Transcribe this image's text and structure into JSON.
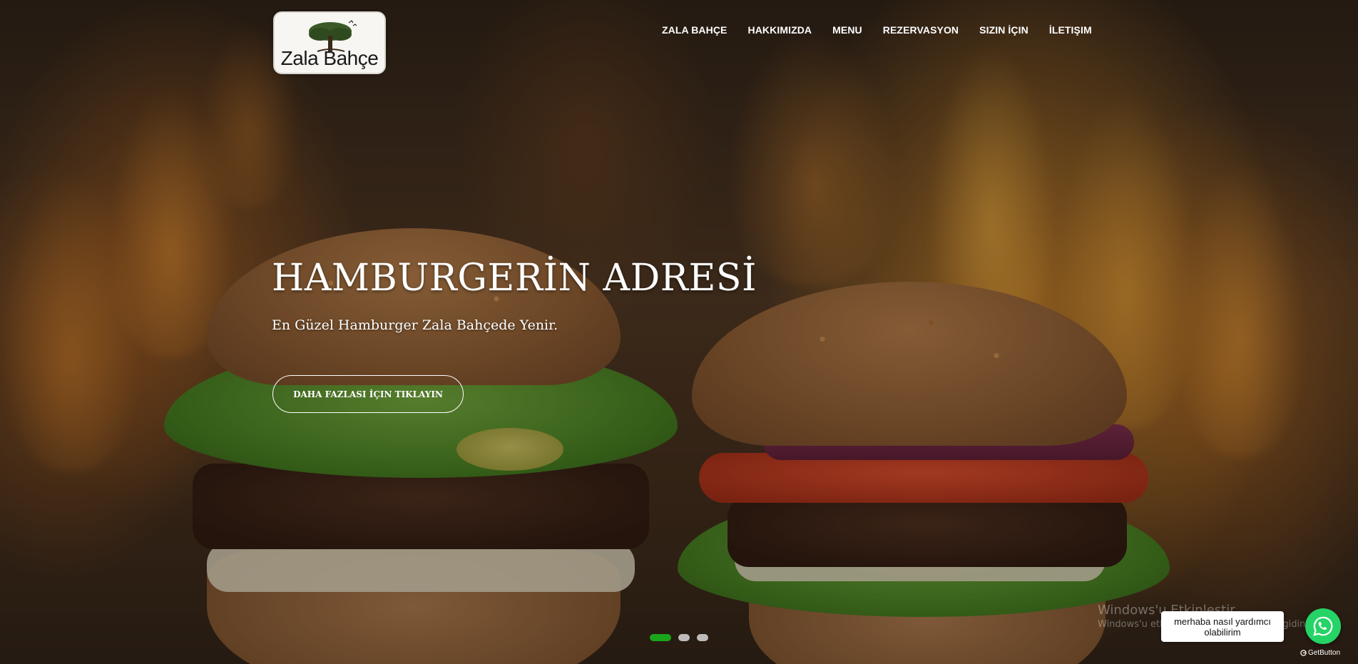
{
  "header": {
    "logo_text": "Zala Bahçe",
    "nav": [
      {
        "label": "ZALA BAHÇE"
      },
      {
        "label": "HAKKIMIZDA"
      },
      {
        "label": "MENU"
      },
      {
        "label": "REZERVASYON"
      },
      {
        "label": "SIZIN İÇIN"
      },
      {
        "label": "İLETIŞIM"
      }
    ]
  },
  "hero": {
    "title": "HAMBURGERİN ADRESİ",
    "subtitle": "En Güzel Hamburger Zala Bahçede Yenir.",
    "cta_label": "DAHA FAZLASI İÇIN TIKLAYIN"
  },
  "slider": {
    "active_slide": 1,
    "slide_count": 3
  },
  "windows_notice": {
    "title": "Windows'u Etkinleştir",
    "subtitle": "Windows'u etkinleştirmek için Ayarlar'a gidin."
  },
  "whatsapp": {
    "bubble_line1": "merhaba nasıl yardımcı",
    "bubble_line2": "olabilirim",
    "icon": "whatsapp-icon",
    "brand_color": "#25d366",
    "getbutton_label": "GetButton"
  },
  "colors": {
    "slider_active": "#1aa51a",
    "text": "#ffffff"
  }
}
